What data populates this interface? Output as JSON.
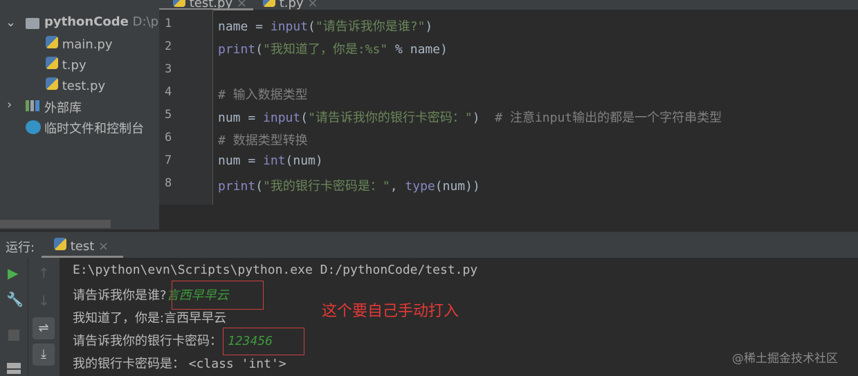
{
  "project": {
    "name": "pythonCode",
    "path": "D:\\py",
    "files": [
      "main.py",
      "t.py",
      "test.py"
    ],
    "external_libs": "外部库",
    "scratches": "临时文件和控制台"
  },
  "editor": {
    "tabs": [
      "test.py",
      "t.py"
    ],
    "lines": [
      [
        {
          "t": "name = ",
          "c": ""
        },
        {
          "t": "input",
          "c": "kw"
        },
        {
          "t": "(",
          "c": ""
        },
        {
          "t": "\"请告诉我你是谁?\"",
          "c": "str"
        },
        {
          "t": ")",
          "c": ""
        }
      ],
      [
        {
          "t": "print",
          "c": "kw"
        },
        {
          "t": "(",
          "c": ""
        },
        {
          "t": "\"我知道了，你是:%s\"",
          "c": "str"
        },
        {
          "t": " % name)",
          "c": ""
        }
      ],
      [],
      [
        {
          "t": "# 输入数据类型",
          "c": "cm"
        }
      ],
      [
        {
          "t": "num = ",
          "c": ""
        },
        {
          "t": "input",
          "c": "kw"
        },
        {
          "t": "(",
          "c": ""
        },
        {
          "t": "\"请告诉我你的银行卡密码：\"",
          "c": "str"
        },
        {
          "t": ")  ",
          "c": ""
        },
        {
          "t": "# 注意input输出的都是一个字符串类型",
          "c": "cm"
        }
      ],
      [
        {
          "t": "# 数据类型转换",
          "c": "cm"
        }
      ],
      [
        {
          "t": "num = ",
          "c": ""
        },
        {
          "t": "int",
          "c": "kw"
        },
        {
          "t": "(num)",
          "c": ""
        }
      ],
      [
        {
          "t": "print",
          "c": "kw"
        },
        {
          "t": "(",
          "c": ""
        },
        {
          "t": "\"我的银行卡密码是：\"",
          "c": "str"
        },
        {
          "t": ", ",
          "c": ""
        },
        {
          "t": "type",
          "c": "kw"
        },
        {
          "t": "(num))",
          "c": ""
        }
      ]
    ]
  },
  "run": {
    "label": "运行:",
    "tab": "test",
    "cmd": "E:\\python\\evn\\Scripts\\python.exe D:/pythonCode/test.py",
    "prompt1": "请告诉我你是谁?",
    "input1": "言西早早云",
    "out2": "我知道了，你是:言西早早云",
    "prompt2": "请告诉我你的银行卡密码：",
    "input2": "123456",
    "out4_prefix": "我的银行卡密码是： ",
    "out4_value": "<class 'int'>"
  },
  "annotation": "这个要自己手动打入",
  "watermark": "@稀土掘金技术社区"
}
